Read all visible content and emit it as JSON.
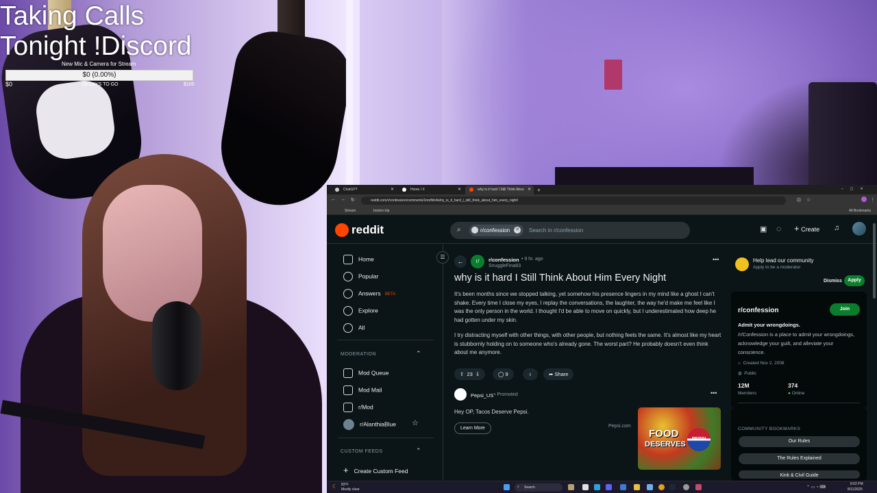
{
  "overlay": {
    "title_line1": "Taking Calls",
    "title_line2": "Tonight !Discord",
    "goal_label": "New Mic & Camera for Stream",
    "goal_progress_text": "$0 (0.00%)",
    "goal_progress": 0,
    "goal_start": "$0",
    "goal_days": "29 DAYS TO GO",
    "goal_end": "$100"
  },
  "browser": {
    "tabs": [
      {
        "label": "ChatGPT",
        "active": false
      },
      {
        "label": "Home / X",
        "active": false
      },
      {
        "label": "why is it hard I Still Think Abou",
        "active": true
      }
    ],
    "url": "reddit.com/r/confession/comments/1mnfbh4/why_is_it_hard_i_still_think_about_him_every_night/",
    "bookmarks": [
      "Stream",
      "boston trip"
    ],
    "all_bookmarks": "All Bookmarks"
  },
  "reddit": {
    "logo_text": "reddit",
    "search": {
      "chip": "r/confession",
      "placeholder": "Search in r/confession"
    },
    "create_label": "Create",
    "nav": {
      "home": "Home",
      "popular": "Popular",
      "answers": "Answers",
      "answers_badge": "BETA",
      "explore": "Explore",
      "all": "All"
    },
    "moderation": {
      "heading": "MODERATION",
      "items": [
        "Mod Queue",
        "Mod Mail",
        "r/Mod",
        "r/AlanthiaBlue"
      ]
    },
    "custom_feeds": {
      "heading": "CUSTOM FEEDS",
      "create": "Create Custom Feed"
    },
    "post": {
      "subreddit": "r/confession",
      "time": "9 hr. ago",
      "author": "SnuggleFina83",
      "title": "why is it hard I Still Think About Him Every Night",
      "para1": "It's been months since we stopped talking, yet somehow his presence lingers in my mind like a ghost I can't shake. Every time I close my eyes, I replay the conversations, the laughter, the way he'd make me feel like I was the only person in the world. I thought I'd be able to move on quickly, but I underestimated how deep he had gotten under my skin.",
      "para2": "I try distracting myself with other things, with other people, but nothing feels the same. It's almost like my heart is stubbornly holding on to someone who's already gone. The worst part? He probably doesn't even think about me anymore.",
      "votes": "23",
      "comments": "9",
      "share": "Share"
    },
    "ad": {
      "advertiser": "Pepsi_US",
      "promoted": "Promoted",
      "text": "Hey OP, Tacos Deserve Pepsi.",
      "cta": "Learn More",
      "domain": "Pepsi.com",
      "image_text_1": "FOOD",
      "image_text_2": "DESERVES",
      "image_logo": "PEPSI"
    },
    "side": {
      "help_title": "Help lead our community",
      "help_sub": "Apply to be a moderator",
      "dismiss": "Dismiss",
      "apply": "Apply",
      "community": "r/confession",
      "join": "Join",
      "tagline": "Admit your wrongdoings.",
      "description": "/r/Confession is a place to admit your wrongdoings, acknowledge your guilt, and alleviate your conscience.",
      "created": "Created Nov 2, 2008",
      "visibility": "Public",
      "members_count": "12M",
      "members_label": "Members",
      "online_count": "374",
      "online_label": "Online",
      "bookmarks_heading": "COMMUNITY BOOKMARKS",
      "bookmarks": [
        "Our Rules",
        "The Rules Explained",
        "Kink & Civil Guide"
      ]
    }
  },
  "taskbar": {
    "weather_temp": "83°F",
    "weather_desc": "Mostly clear",
    "search": "Search",
    "time": "8:02 PM",
    "date": "8/11/2025"
  },
  "colors": {
    "reddit_orange": "#ff4500",
    "join_green": "#0a7e2c",
    "online_dot": "#46d160"
  }
}
